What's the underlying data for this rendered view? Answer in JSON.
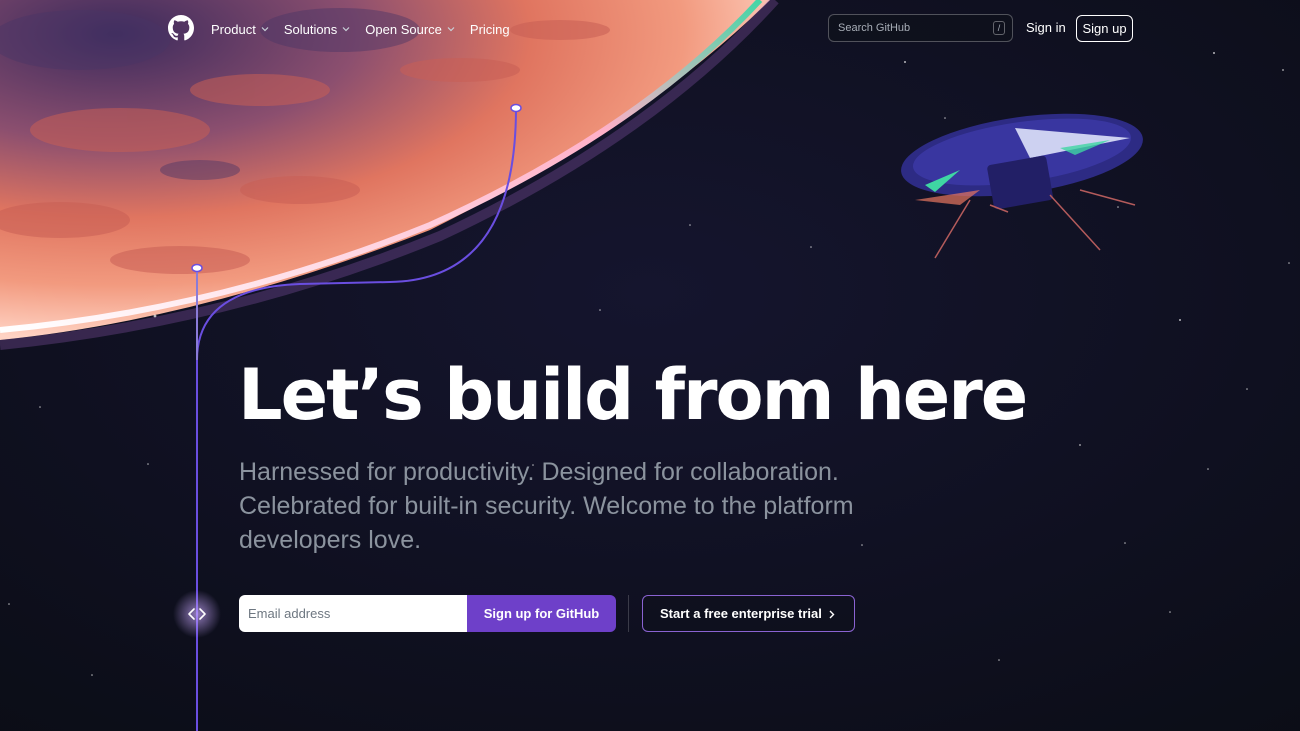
{
  "header": {
    "nav": [
      {
        "label": "Product",
        "has_dropdown": true
      },
      {
        "label": "Solutions",
        "has_dropdown": true
      },
      {
        "label": "Open Source",
        "has_dropdown": true
      },
      {
        "label": "Pricing",
        "has_dropdown": false
      }
    ],
    "search_placeholder": "Search GitHub",
    "search_shortcut": "/",
    "sign_in": "Sign in",
    "sign_up": "Sign up"
  },
  "hero": {
    "title": "Let’s build from here",
    "subtitle": "Harnessed for productivity. Designed for collaboration. Celebrated for built-in security. Welcome to the platform developers love.",
    "email_placeholder": "Email address",
    "primary_cta": "Sign up for GitHub",
    "secondary_cta": "Start a free enterprise trial"
  },
  "icons": [
    "github-logo-icon",
    "chevron-down-icon",
    "code-icon",
    "chevron-right-icon"
  ],
  "colors": {
    "background": "#0d1117",
    "accent_purple": "#6e40c9",
    "subtitle_gray": "#8b939e",
    "planet_orange": "#e8765f"
  }
}
